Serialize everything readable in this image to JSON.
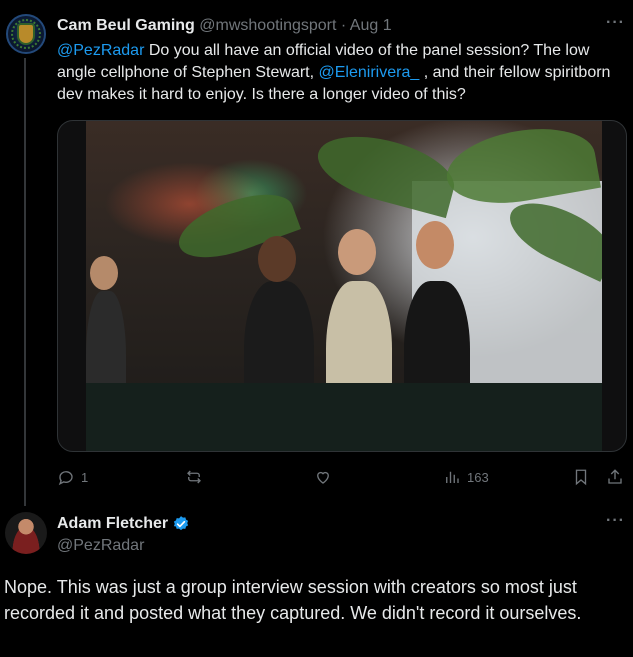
{
  "tweet1": {
    "author": {
      "display_name": "Cam Beul Gaming",
      "handle": "@mwshootingsport",
      "separator": "·",
      "date": "Aug 1"
    },
    "more_label": "···",
    "text_parts": {
      "mention1": "@PezRadar",
      "part1": " Do you all have an official video of the panel session? The low angle cellphone of Stephen Stewart, ",
      "mention2": "@Elenirivera_",
      "part2": " , and their fellow spiritborn dev makes it hard to enjoy. Is there a longer video of this?"
    },
    "actions": {
      "replies": "1",
      "reposts": "",
      "likes": "",
      "views": "163"
    }
  },
  "tweet2": {
    "author": {
      "display_name": "Adam Fletcher",
      "handle": "@PezRadar",
      "verified": true
    },
    "more_label": "···",
    "text": "Nope. This was just a group interview session with creators so most just recorded it and posted what they captured.  We didn't record it ourselves."
  },
  "colors": {
    "background": "#000000",
    "text": "#e7e9ea",
    "muted": "#71767b",
    "accent": "#1d9bf0",
    "border": "#2f3336"
  },
  "icons": {
    "reply": "reply-icon",
    "repost": "repost-icon",
    "like": "heart-icon",
    "views": "views-icon",
    "bookmark": "bookmark-icon",
    "share": "share-icon",
    "verified": "verified-badge-icon"
  }
}
